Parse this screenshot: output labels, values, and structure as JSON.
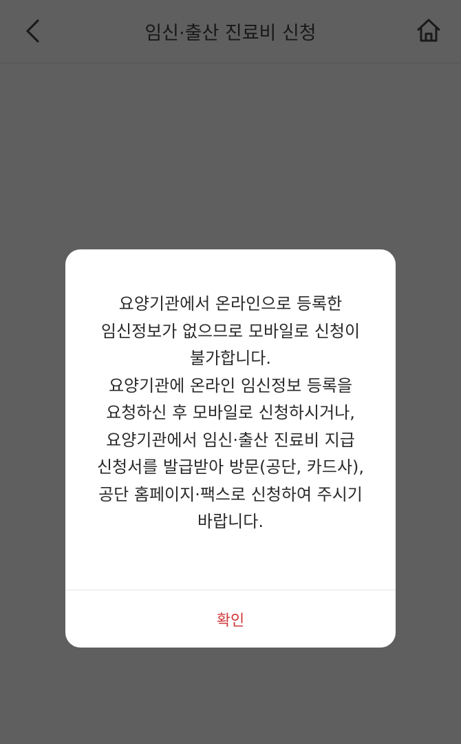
{
  "header": {
    "title": "임신·출산 진료비 신청",
    "back_icon": "chevron-left-icon",
    "home_icon": "home-icon"
  },
  "dialog": {
    "paragraph_1": "요양기관에서 온라인으로 등록한 임신정보가 없으므로 모바일로 신청이 불가합니다.",
    "paragraph_2": "요양기관에 온라인 임신정보 등록을 요청하신 후 모바일로 신청하시거나, 요양기관에서 임신·출산 진료비 지급 신청서를 발급받아 방문(공단, 카드사), 공단 홈페이지·팩스로 신청하여 주시기 바랍니다.",
    "confirm_label": "확인"
  },
  "colors": {
    "dim_background": "#5f5f5f",
    "dialog_background": "#ffffff",
    "confirm_text": "#d0393a",
    "body_text": "#2a2a2a"
  }
}
